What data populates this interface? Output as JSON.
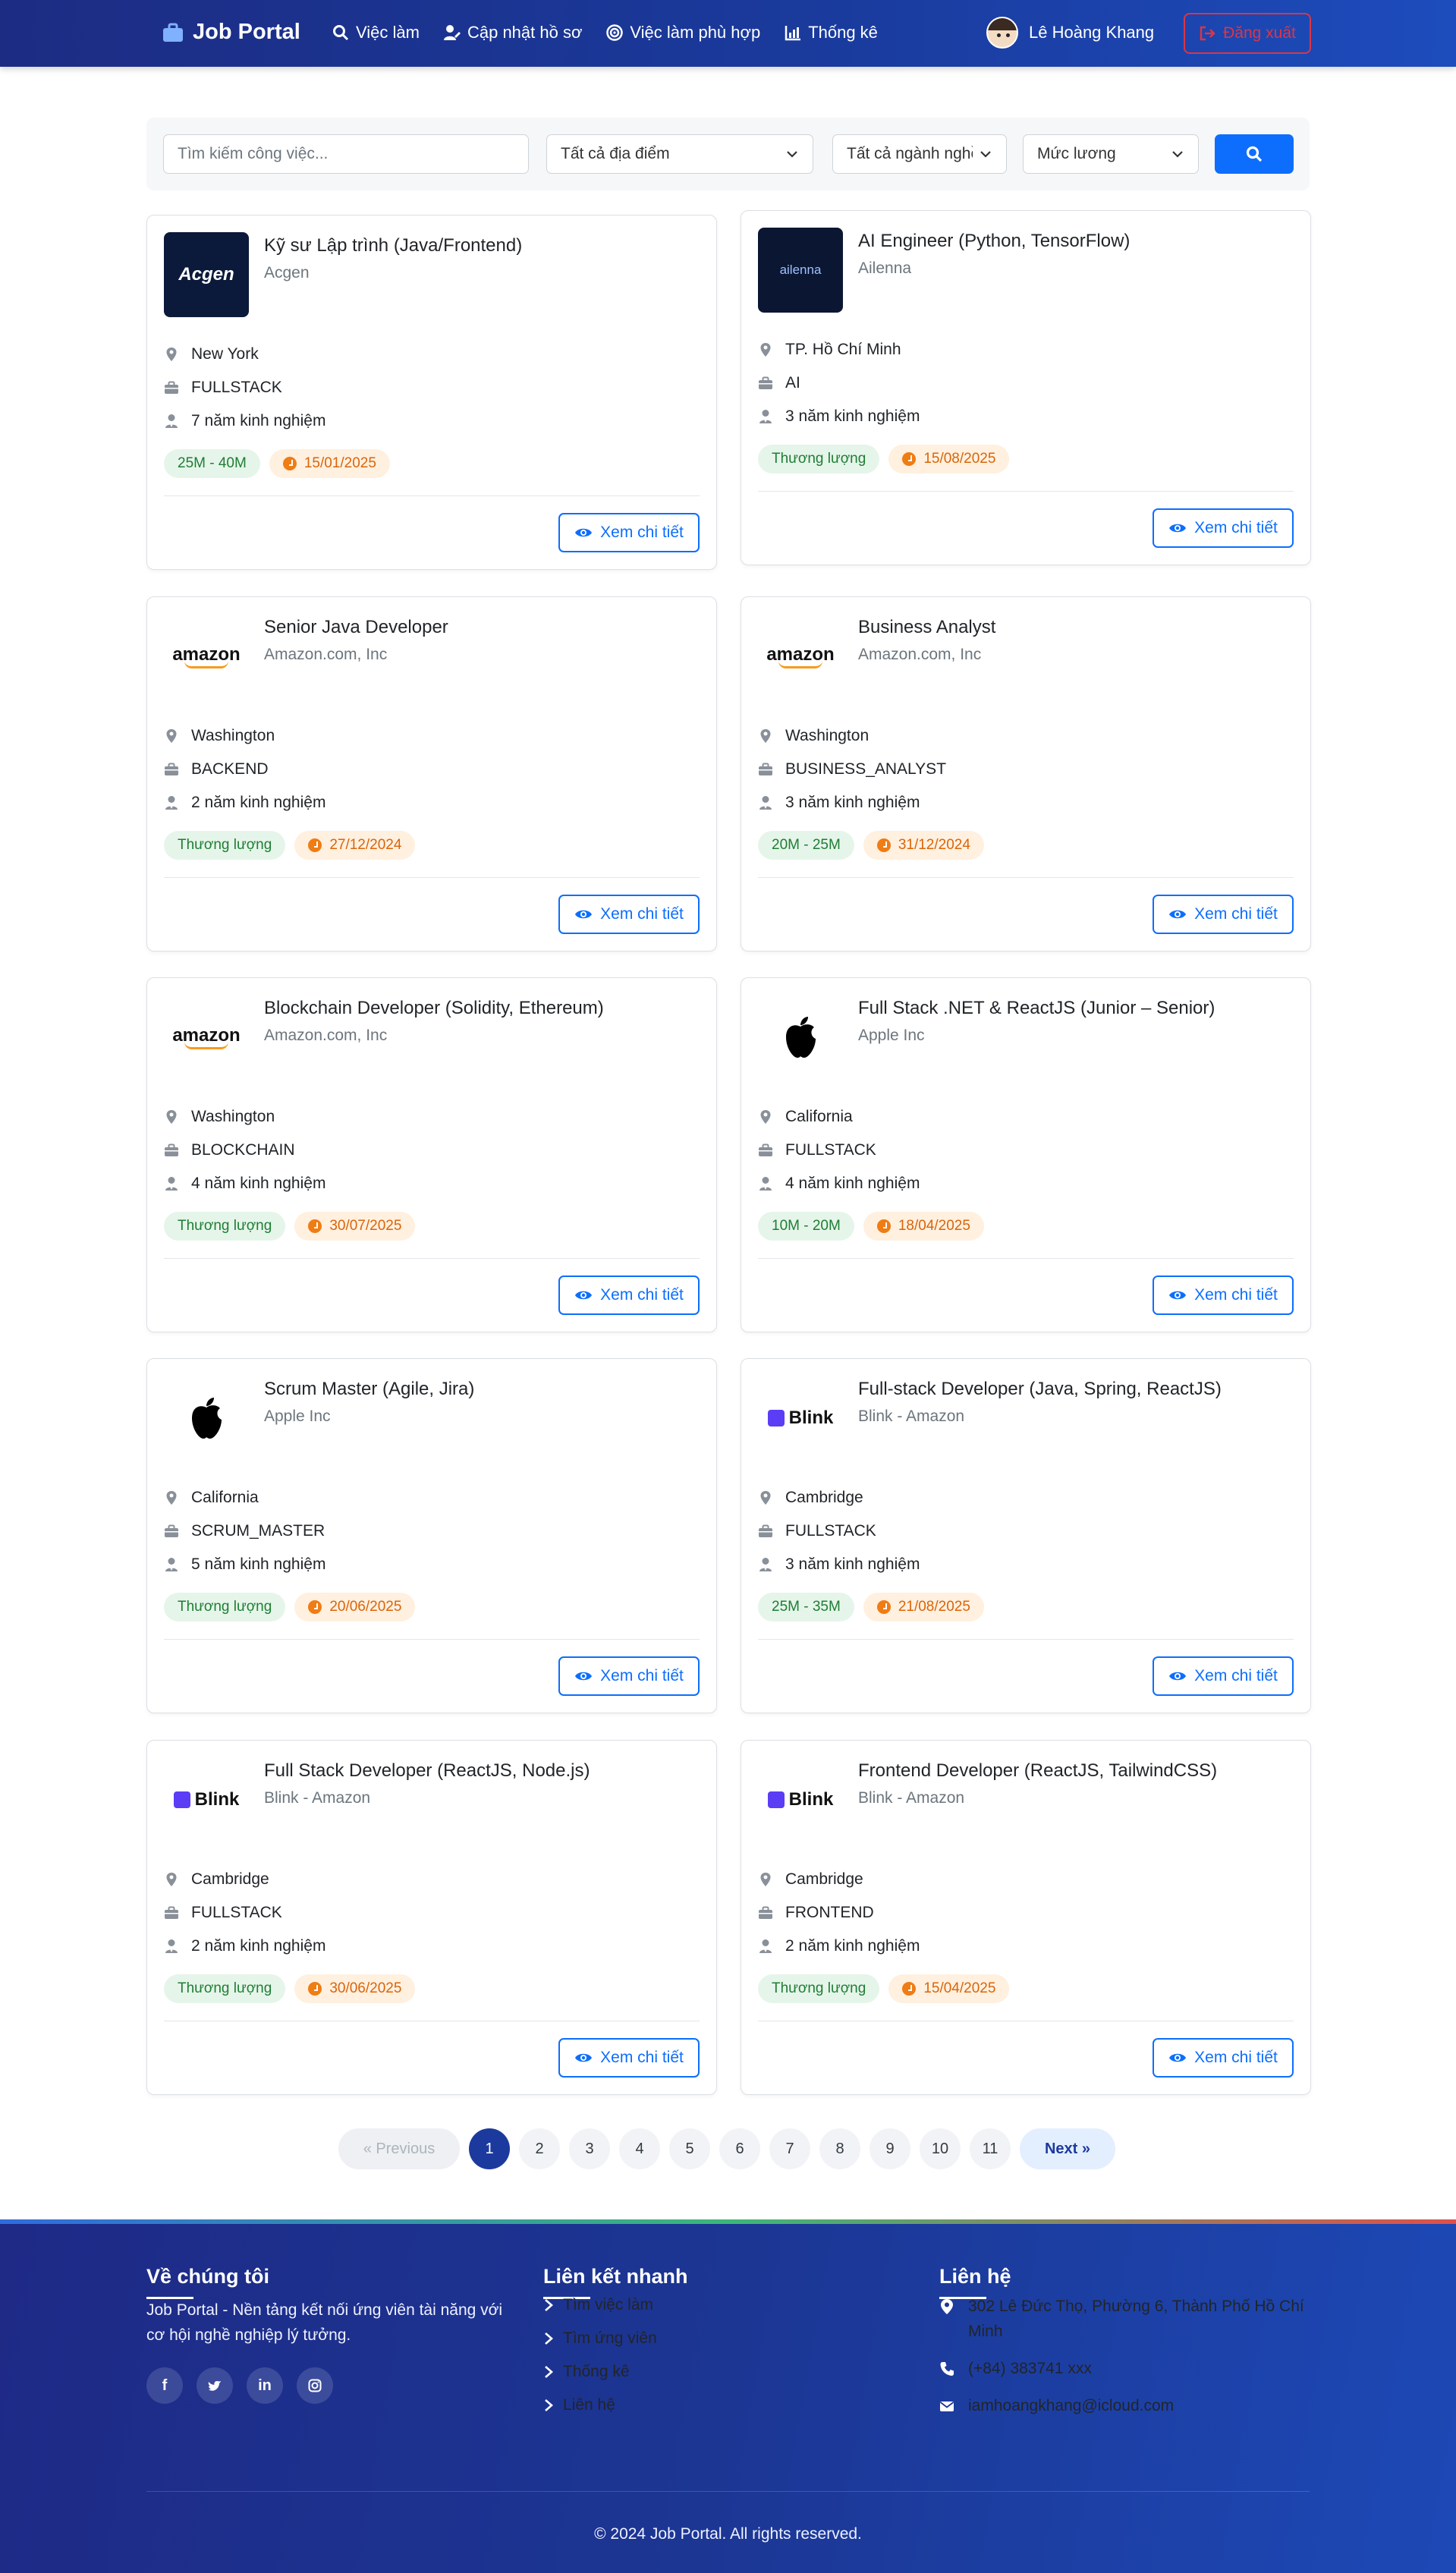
{
  "navbar": {
    "brand": "Job Portal",
    "links": [
      "Việc làm",
      "Cập nhật hồ sơ",
      "Việc làm phù hợp",
      "Thống kê"
    ],
    "user_name": "Lê Hoàng Khang",
    "logout": "Đăng xuất"
  },
  "search": {
    "keyword_placeholder": "Tìm kiếm công việc...",
    "location": "Tất cả địa điểm",
    "industry": "Tất cả ngành nghề",
    "salary": "Mức lương"
  },
  "detail_label": "Xem chi tiết",
  "jobs": [
    {
      "title": "Kỹ sư Lập trình (Java/Frontend)",
      "company": "Acgen",
      "location": "New York",
      "category": "FULLSTACK",
      "experience": "7 năm kinh nghiệm",
      "salary": "25M - 40M",
      "deadline": "15/01/2025",
      "logo": "Acgen"
    },
    {
      "title": "AI Engineer (Python, TensorFlow)",
      "company": "Ailenna",
      "location": "TP. Hồ Chí Minh",
      "category": "AI",
      "experience": "3 năm kinh nghiệm",
      "salary": "Thương lượng",
      "deadline": "15/08/2025",
      "logo": "ailenna"
    },
    {
      "title": "Senior Java Developer",
      "company": "Amazon.com, Inc",
      "location": "Washington",
      "category": "BACKEND",
      "experience": "2 năm kinh nghiệm",
      "salary": "Thương lượng",
      "deadline": "27/12/2024",
      "logo": "amazon"
    },
    {
      "title": "Business Analyst",
      "company": "Amazon.com, Inc",
      "location": "Washington",
      "category": "BUSINESS_ANALYST",
      "experience": "3 năm kinh nghiệm",
      "salary": "20M - 25M",
      "deadline": "31/12/2024",
      "logo": "amazon"
    },
    {
      "title": "Blockchain Developer (Solidity, Ethereum)",
      "company": "Amazon.com, Inc",
      "location": "Washington",
      "category": "BLOCKCHAIN",
      "experience": "4 năm kinh nghiệm",
      "salary": "Thương lượng",
      "deadline": "30/07/2025",
      "logo": "amazon"
    },
    {
      "title": "Full Stack .NET & ReactJS (Junior – Senior)",
      "company": "Apple Inc",
      "location": "California",
      "category": "FULLSTACK",
      "experience": "4 năm kinh nghiệm",
      "salary": "10M - 20M",
      "deadline": "18/04/2025",
      "logo": "apple"
    },
    {
      "title": "Scrum Master (Agile, Jira)",
      "company": "Apple Inc",
      "location": "California",
      "category": "SCRUM_MASTER",
      "experience": "5 năm kinh nghiệm",
      "salary": "Thương lượng",
      "deadline": "20/06/2025",
      "logo": "apple"
    },
    {
      "title": "Full-stack Developer (Java, Spring, ReactJS)",
      "company": "Blink - Amazon",
      "location": "Cambridge",
      "category": "FULLSTACK",
      "experience": "3 năm kinh nghiệm",
      "salary": "25M - 35M",
      "deadline": "21/08/2025",
      "logo": "Blink"
    },
    {
      "title": "Full Stack Developer (ReactJS, Node.js)",
      "company": "Blink - Amazon",
      "location": "Cambridge",
      "category": "FULLSTACK",
      "experience": "2 năm kinh nghiệm",
      "salary": "Thương lượng",
      "deadline": "30/06/2025",
      "logo": "Blink"
    },
    {
      "title": "Frontend Developer (ReactJS, TailwindCSS)",
      "company": "Blink - Amazon",
      "location": "Cambridge",
      "category": "FRONTEND",
      "experience": "2 năm kinh nghiệm",
      "salary": "Thương lượng",
      "deadline": "15/04/2025",
      "logo": "Blink"
    }
  ],
  "pagination": {
    "prev": "« Previous",
    "pages": [
      "1",
      "2",
      "3",
      "4",
      "5",
      "6",
      "7",
      "8",
      "9",
      "10",
      "11"
    ],
    "active": "1",
    "next": "Next »"
  },
  "footer": {
    "about_title": "Về chúng tôi",
    "about_text": "Job Portal - Nền tảng kết nối ứng viên tài năng với cơ hội nghề nghiệp lý tưởng.",
    "social_icons": [
      "facebook-icon",
      "twitter-icon",
      "linkedin-icon",
      "instagram-icon"
    ],
    "links_title": "Liên kết nhanh",
    "links": [
      "Tìm việc làm",
      "Tìm ứng viên",
      "Thống kê",
      "Liên hệ"
    ],
    "contact_title": "Liên hệ",
    "address": "302 Lê Đức Thọ, Phường 6, Thành Phố Hồ Chí Minh",
    "phone": "(+84) 383741 xxx",
    "email": "iamhoangkhang@icloud.com",
    "copyright": "© 2024 Job Portal. All rights reserved."
  },
  "colors": {
    "primary": "#0d6efd",
    "nav": "#1c2c83",
    "danger": "#dc3545",
    "salary_badge": "#e6f5ea",
    "date_badge": "#fff0df"
  }
}
